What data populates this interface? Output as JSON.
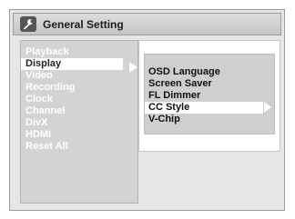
{
  "header": {
    "title": "General Setting",
    "icon": "wrench-icon"
  },
  "left_menu": {
    "items": [
      {
        "label": "Playback"
      },
      {
        "label": "Display",
        "selected": true
      },
      {
        "label": "Video"
      },
      {
        "label": "Recording"
      },
      {
        "label": "Clock"
      },
      {
        "label": "Channel"
      },
      {
        "label": "DivX"
      },
      {
        "label": "HDMI"
      },
      {
        "label": "Reset All"
      }
    ]
  },
  "right_menu": {
    "items": [
      {
        "label": "OSD Language"
      },
      {
        "label": "Screen Saver"
      },
      {
        "label": "FL Dimmer"
      },
      {
        "label": "CC Style",
        "selected": true
      },
      {
        "label": "V-Chip"
      }
    ]
  },
  "colors": {
    "background": "#e6e6e6",
    "highlight": "#ffffff",
    "inactive_text": "#ffffff",
    "active_text": "#111111"
  }
}
